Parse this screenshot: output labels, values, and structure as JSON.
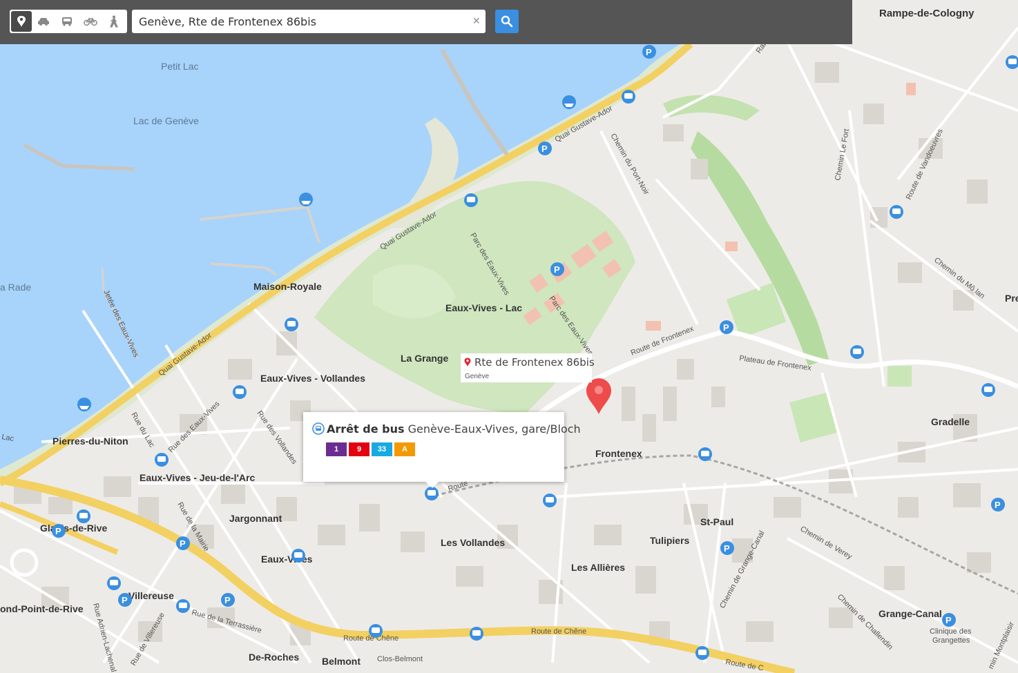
{
  "search": {
    "value": "Genève, Rte de Frontenex 86bis",
    "clear_label": "×"
  },
  "modes": [
    "marker-icon",
    "car-icon",
    "bus-icon",
    "bike-icon",
    "walk-icon"
  ],
  "selected_place": {
    "name": "Rte de Frontenex 86bis",
    "city": "Genève"
  },
  "popup": {
    "type_label": "Arrêt de bus",
    "stop_name": "Genève-Eaux-Vives, gare/Bloch",
    "lines": [
      {
        "label": "1",
        "color": "#6a2c91"
      },
      {
        "label": "9",
        "color": "#e3000f"
      },
      {
        "label": "33",
        "color": "#19a9e1"
      },
      {
        "label": "A",
        "color": "#f29a00"
      }
    ]
  },
  "labels": {
    "rampe": "Rampe-de-Cologny",
    "petit_lac": "Petit Lac",
    "lac": "Lac de Genève",
    "rade": "a Rade",
    "maison": "Maison-Royale",
    "ev_lac": "Eaux-Vives - Lac",
    "la_grange": "La Grange",
    "ev_voll": "Eaux-Vives - Vollandes",
    "pierres": "Pierres-du-Niton",
    "ev_jeu": "Eaux-Vives - Jeu-de-l'Arc",
    "jargonnant": "Jargonnant",
    "glacis": "Glacis-de-Rive",
    "eaux_vives": "Eaux-Vives",
    "villereuse": "Villereuse",
    "rond_point": "ond-Point-de-Rive",
    "de_roches": "De-Roches",
    "belmont": "Belmont",
    "clos": "Clos-Belmont",
    "vollandes": "Les Vollandes",
    "allieres": "Les Allières",
    "tulipiers": "Tulipiers",
    "st_paul": "St-Paul",
    "frontenex": "Frontenex",
    "gradelle": "Gradelle",
    "grange_canal": "Grange-Canal",
    "clinique": "Clinique des",
    "grangettes": "Grangettes",
    "pre": "Pre",
    "quai1": "Quai Gustave-Ador",
    "quai2": "Quai Gustave-Ador",
    "quai3": "Quai Gustave-Ador",
    "parc": "Parc des Eaux-Vives",
    "parc2": "Parc des Eaux-Vives",
    "port_noir": "Chemin du Port-Noir",
    "rte_front": "Route de Frontenex",
    "rte_front2": "Route de Frontenex",
    "plateau": "Plateau de Frontenex",
    "ch_fort": "Chemin Le Fort",
    "vandoeuvres": "Route de Vandoeuvres",
    "molan": "Chemin du Mô lan",
    "verey": "Chemin de Verey",
    "grange_canal_ch": "Chemin de Grange-Canal",
    "challendin": "Chemin de Challendin",
    "rte_chene": "Route de Chêne",
    "rte_chene2": "Route de Chêne",
    "rte_chene3": "Route de C",
    "jetee": "Jetée des Eaux-Vives",
    "rue_lac": "Rue du Lac",
    "rue_ev": "Rue des Eaux-Vives",
    "rue_voll": "Rue des Vollandes",
    "rue_maire": "Rue de la Mairie",
    "terrassiere": "Rue de la Terrassière",
    "lachenal": "Rue Adrien-Lachenal",
    "villereuse_rue": "Rue de Villereuse",
    "routes": "Route",
    "rte_lac": "Lac",
    "montplaisir": "min Montplaisir",
    "rampe_road": "Ram"
  }
}
